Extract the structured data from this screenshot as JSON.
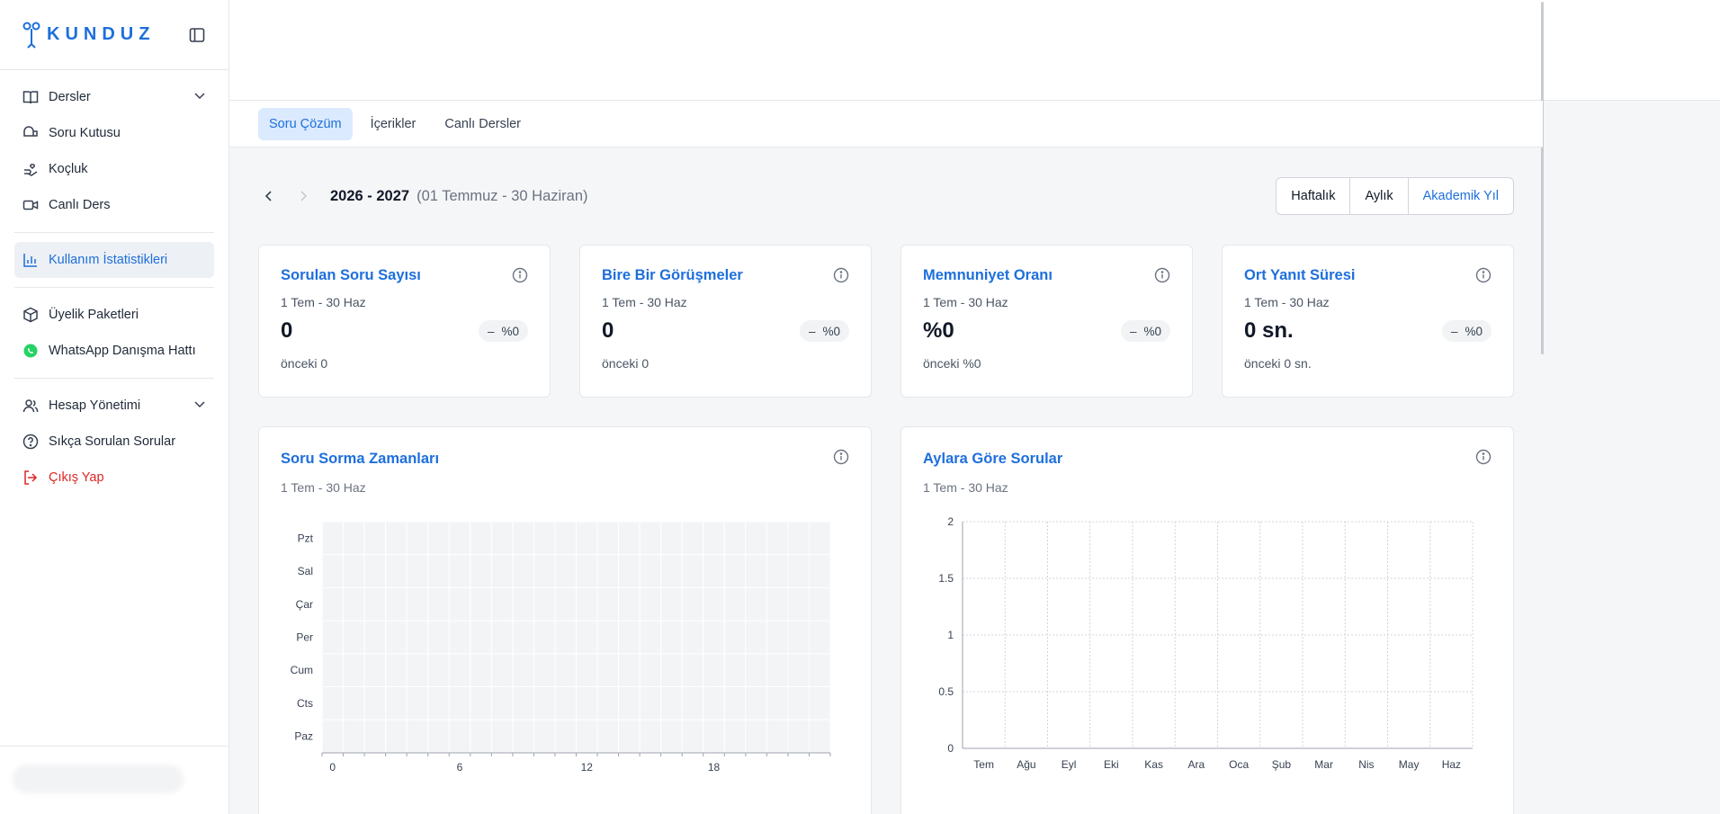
{
  "brand": {
    "name": "KUNDUZ",
    "accent": "#1d6fdc"
  },
  "sidebar": {
    "items": [
      {
        "label": "Dersler",
        "icon": "book-icon",
        "chevron": true
      },
      {
        "label": "Soru Kutusu",
        "icon": "inbox-icon"
      },
      {
        "label": "Koçluk",
        "icon": "hand-heart-icon"
      },
      {
        "label": "Canlı Ders",
        "icon": "video-icon"
      },
      {
        "label": "Kullanım İstatistikleri",
        "icon": "bar-chart-icon",
        "active": true
      },
      {
        "label": "Üyelik Paketleri",
        "icon": "package-icon"
      },
      {
        "label": "WhatsApp Danışma Hattı",
        "icon": "whatsapp-icon"
      },
      {
        "label": "Hesap Yönetimi",
        "icon": "users-icon",
        "chevron": true
      },
      {
        "label": "Sıkça Sorulan Sorular",
        "icon": "help-circle-icon"
      },
      {
        "label": "Çıkış Yap",
        "icon": "logout-icon"
      }
    ]
  },
  "tabs": [
    "Soru Çözüm",
    "İçerikler",
    "Canlı Dersler"
  ],
  "period": {
    "year": "2026 - 2027",
    "range": "(01 Temmuz - 30 Haziran)",
    "options": [
      "Haftalık",
      "Aylık",
      "Akademik Yıl"
    ],
    "selected": "Akademik Yıl"
  },
  "stats": [
    {
      "title": "Sorulan Soru Sayısı",
      "sub": "1 Tem - 30 Haz",
      "value": "0",
      "change": "%0",
      "prev": "önceki 0"
    },
    {
      "title": "Bire Bir Görüşmeler",
      "sub": "1 Tem - 30 Haz",
      "value": "0",
      "change": "%0",
      "prev": "önceki 0"
    },
    {
      "title": "Memnuniyet Oranı",
      "sub": "1 Tem - 30 Haz",
      "value": "%0",
      "change": "%0",
      "prev": "önceki %0"
    },
    {
      "title": "Ort Yanıt Süresi",
      "sub": "1 Tem - 30 Haz",
      "value": "0 sn.",
      "change": "%0",
      "prev": "önceki 0 sn."
    }
  ],
  "charts_meta": {
    "heatmap": {
      "title": "Soru Sorma Zamanları",
      "sub": "1 Tem - 30 Haz"
    },
    "monthly": {
      "title": "Aylara Göre Sorular",
      "sub": "1 Tem - 30 Haz"
    }
  },
  "chart_data": [
    {
      "type": "heatmap",
      "y_categories": [
        "Pzt",
        "Sal",
        "Çar",
        "Per",
        "Cum",
        "Cts",
        "Paz"
      ],
      "x_range": [
        0,
        24
      ],
      "x_ticks": [
        "0",
        "6",
        "12",
        "18"
      ],
      "values": "all zero",
      "cell_color": "#f3f4f6"
    },
    {
      "type": "bar",
      "categories": [
        "Tem",
        "Ağu",
        "Eyl",
        "Eki",
        "Kas",
        "Ara",
        "Oca",
        "Şub",
        "Mar",
        "Nis",
        "May",
        "Haz"
      ],
      "values": [
        0,
        0,
        0,
        0,
        0,
        0,
        0,
        0,
        0,
        0,
        0,
        0
      ],
      "ylim": [
        0,
        2
      ],
      "y_ticks": [
        "0",
        "0.5",
        "1",
        "1.5",
        "2"
      ],
      "grid": true
    }
  ]
}
